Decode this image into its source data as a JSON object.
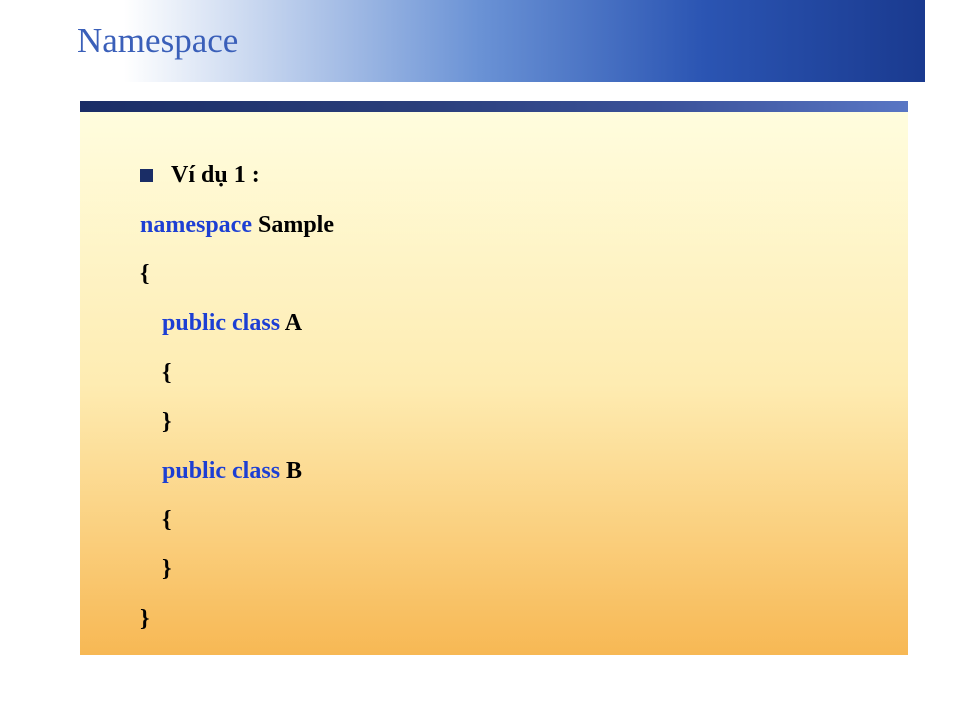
{
  "header": {
    "title": "Namespace"
  },
  "content": {
    "bullet_label": "Ví dụ 1 :",
    "line1_kw": "namespace",
    "line1_rest": "  Sample",
    "open_brace": "{",
    "classA_kw": "public class ",
    "classA_name": "A",
    "inner_open": "{",
    "inner_close": "}",
    "classB_kw": "public class ",
    "classB_name": "B",
    "close_brace": "}"
  }
}
